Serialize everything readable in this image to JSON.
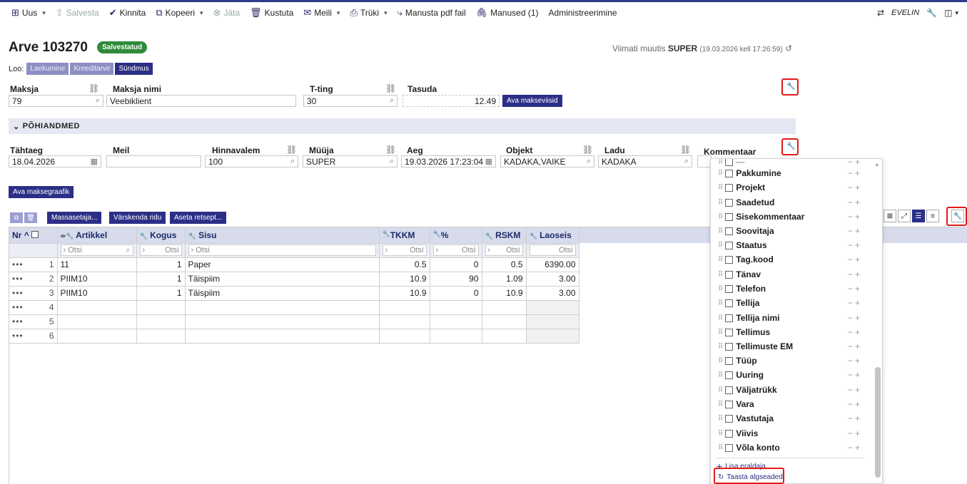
{
  "toolbar": {
    "new": "Uus",
    "save": "Salvesta",
    "confirm": "Kinnita",
    "copy": "Kopeeri",
    "skip": "Jäta",
    "delete": "Kustuta",
    "email": "Meili",
    "print": "Trüki",
    "attach_pdf": "Manusta pdf fail",
    "attachments": "Manused (1)",
    "admin": "Administreerimine",
    "user": "EVELIN"
  },
  "document": {
    "title": "Arve 103270",
    "status": "Salvestatud",
    "last_modified_label": "Viimati muutis",
    "last_modified_user": "SUPER",
    "last_modified_time": "(19.03.2026 kell 17:26:59)"
  },
  "create": {
    "label": "Loo:",
    "buttons": [
      "Laekumine",
      "Kreeditarve",
      "Sündmus"
    ]
  },
  "header_fields": {
    "payer_label": "Maksja",
    "payer_value": "79",
    "payer_name_label": "Maksja nimi",
    "payer_name_value": "Veebiklient",
    "terms_label": "T-ting",
    "terms_value": "30",
    "to_pay_label": "Tasuda",
    "to_pay_value": "12.49",
    "payment_methods_button": "Ava makseviisid"
  },
  "section": {
    "title": "PÕHIANDMED"
  },
  "main_fields": {
    "due_label": "Tähtaeg",
    "due_value": "18.04.2026",
    "email_label": "Meil",
    "email_value": "",
    "price_formula_label": "Hinnavalem",
    "price_formula_value": "100",
    "seller_label": "Müüja",
    "seller_value": "SUPER",
    "time_label": "Aeg",
    "time_value": "19.03.2026 17:23:04",
    "object_label": "Objekt",
    "object_value": "KADAKA,VAIKE",
    "warehouse_label": "Ladu",
    "warehouse_value": "KADAKA",
    "comment_label": "Kommentaar",
    "payment_schedule_button": "Ava maksegraafik"
  },
  "row_actions": {
    "mass_setter": "Massasetaja...",
    "refresh_rows": "Värskenda ridu",
    "set_recipe": "Aseta retsept..."
  },
  "grid": {
    "columns": {
      "nr": "Nr",
      "article": "Artikkel",
      "quantity": "Kogus",
      "content": "Sisu",
      "tkkm": "TKKM",
      "percent": "%",
      "rskm": "RSKM",
      "stock": "Laoseis"
    },
    "filter_placeholder": "Otsi",
    "rows": [
      {
        "nr": "1",
        "article": "11",
        "quantity": "1",
        "content": "Paper",
        "tkkm": "0.5",
        "percent": "0",
        "rskm": "0.5",
        "stock": "6390.00"
      },
      {
        "nr": "2",
        "article": "PIIM10",
        "quantity": "1",
        "content": "Täispiim",
        "tkkm": "10.9",
        "percent": "90",
        "rskm": "1.09",
        "stock": "3.00"
      },
      {
        "nr": "3",
        "article": "PIIM10",
        "quantity": "1",
        "content": "Täispiim",
        "tkkm": "10.9",
        "percent": "0",
        "rskm": "10.9",
        "stock": "3.00"
      },
      {
        "nr": "4",
        "article": "",
        "quantity": "",
        "content": "",
        "tkkm": "",
        "percent": "",
        "rskm": "",
        "stock": ""
      },
      {
        "nr": "5",
        "article": "",
        "quantity": "",
        "content": "",
        "tkkm": "",
        "percent": "",
        "rskm": "",
        "stock": ""
      },
      {
        "nr": "6",
        "article": "",
        "quantity": "",
        "content": "",
        "tkkm": "",
        "percent": "",
        "rskm": "",
        "stock": ""
      }
    ]
  },
  "field_chooser": {
    "items": [
      "Pakkumine",
      "Projekt",
      "Saadetud",
      "Sisekommentaar",
      "Soovitaja",
      "Staatus",
      "Tag.kood",
      "Tänav",
      "Telefon",
      "Tellija",
      "Tellija nimi",
      "Tellimus",
      "Tellimuste EM",
      "Tüüp",
      "Uuring",
      "Väljatrükk",
      "Vara",
      "Vastutaja",
      "Viivis",
      "Võla konto"
    ],
    "add_separator": "Lisa eraldaja",
    "restore_defaults": "Taasta algseaded"
  },
  "colors": {
    "accent": "#2b2f86",
    "saved_badge": "#2f8a3a",
    "highlight": "#e01b1b",
    "grid_header": "#d7dbeb"
  }
}
